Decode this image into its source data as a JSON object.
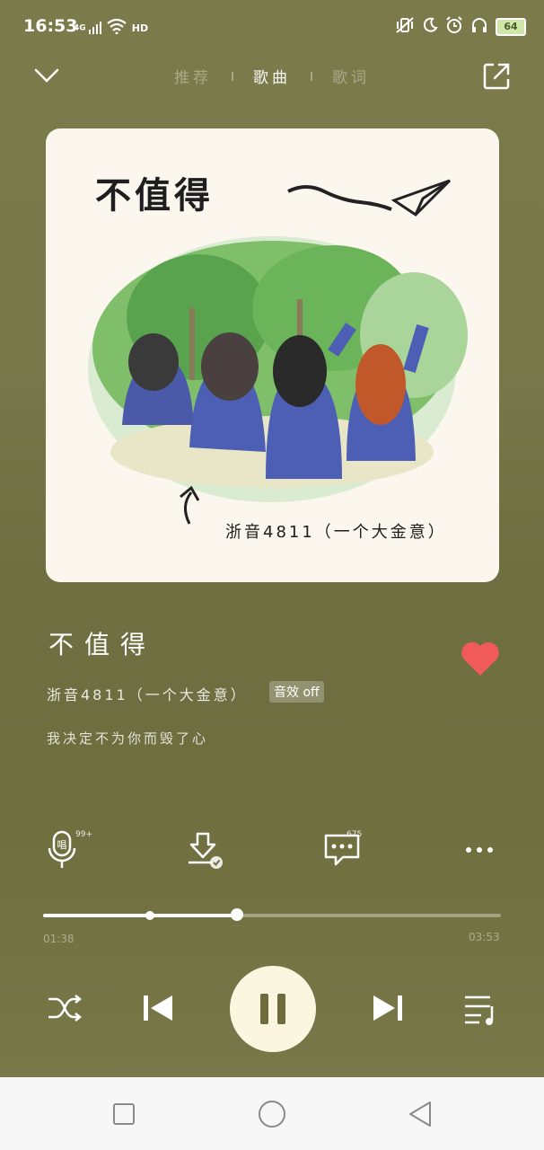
{
  "status_bar": {
    "time": "16:53",
    "signal": "4G",
    "wifi_label": "HD",
    "battery": "64"
  },
  "nav": {
    "tabs": [
      {
        "label": "推荐",
        "active": false
      },
      {
        "label": "歌曲",
        "active": true
      },
      {
        "label": "歌词",
        "active": false
      }
    ]
  },
  "album_art": {
    "title_text": "不值得",
    "caption_text": "浙音4811（一个大金意）"
  },
  "song": {
    "title": "不值得",
    "artist": "浙音4811（一个大金意）",
    "sound_effect_badge": "音效 off",
    "current_lyric": "我决定不为你而毁了心",
    "liked": true
  },
  "actions": {
    "sing_badge": "99+",
    "comments_badge": "675"
  },
  "player": {
    "current_time": "01:38",
    "total_time": "03:53",
    "progress_fraction": 0.42,
    "buffered_fraction": 0.23,
    "state": "playing"
  },
  "colors": {
    "accent_heart": "#f05a5a",
    "play_button": "#fbf6e0",
    "background": "#767646"
  }
}
